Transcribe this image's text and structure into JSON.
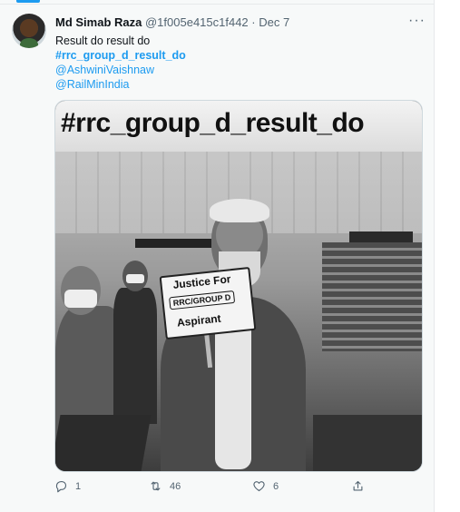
{
  "tweet": {
    "author_name": "Md Simab Raza",
    "author_handle": "@1f005e415c1f442",
    "separator": "·",
    "date": "Dec 7",
    "more_icon": "more-horizontal-icon",
    "text": "Result do result do",
    "hashtag": "#rrc_group_d_result_do",
    "mentions": [
      "@AshwiniVaishnaw",
      "@RailMinIndia"
    ],
    "media": {
      "banner_text": "#rrc_group_d_result_do",
      "placard_line1": "Justice For",
      "placard_line2": "RRC/GROUP D",
      "placard_line3": "Aspirant"
    },
    "actions": {
      "reply_count": "1",
      "retweet_count": "46",
      "like_count": "6",
      "reply_icon": "reply-icon",
      "retweet_icon": "retweet-icon",
      "like_icon": "heart-icon",
      "share_icon": "share-icon"
    }
  },
  "colors": {
    "link": "#1d9bf0",
    "text_primary": "#0f1419",
    "text_secondary": "#536471",
    "background": "#f7f9f9"
  }
}
